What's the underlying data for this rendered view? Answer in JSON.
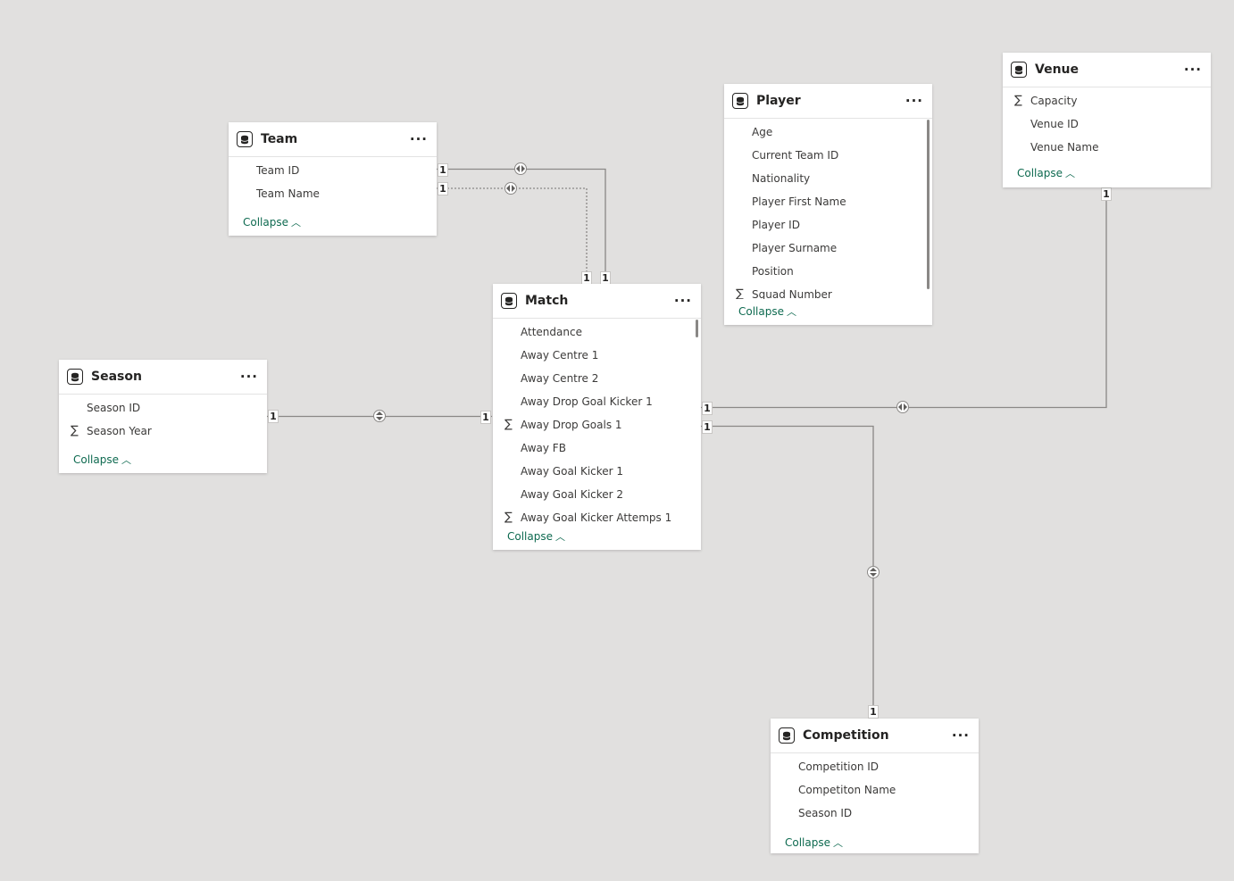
{
  "tables": {
    "team": {
      "title": "Team",
      "fields": [
        {
          "label": "Team ID",
          "sigma": false
        },
        {
          "label": "Team Name",
          "sigma": false
        }
      ],
      "collapse": "Collapse"
    },
    "match": {
      "title": "Match",
      "fields": [
        {
          "label": "Attendance",
          "sigma": false
        },
        {
          "label": "Away Centre 1",
          "sigma": false
        },
        {
          "label": "Away Centre 2",
          "sigma": false
        },
        {
          "label": "Away Drop Goal Kicker 1",
          "sigma": false
        },
        {
          "label": "Away Drop Goals 1",
          "sigma": true
        },
        {
          "label": "Away FB",
          "sigma": false
        },
        {
          "label": "Away Goal Kicker 1",
          "sigma": false
        },
        {
          "label": "Away Goal Kicker 2",
          "sigma": false
        },
        {
          "label": "Away Goal Kicker Attemps 1",
          "sigma": true
        }
      ],
      "collapse": "Collapse"
    },
    "season": {
      "title": "Season",
      "fields": [
        {
          "label": "Season ID",
          "sigma": false
        },
        {
          "label": "Season Year",
          "sigma": true
        }
      ],
      "collapse": "Collapse"
    },
    "player": {
      "title": "Player",
      "fields": [
        {
          "label": "Age",
          "sigma": false
        },
        {
          "label": "Current Team ID",
          "sigma": false
        },
        {
          "label": "Nationality",
          "sigma": false
        },
        {
          "label": "Player First Name",
          "sigma": false
        },
        {
          "label": "Player ID",
          "sigma": false
        },
        {
          "label": "Player Surname",
          "sigma": false
        },
        {
          "label": "Position",
          "sigma": false
        },
        {
          "label": "Squad Number",
          "sigma": true
        }
      ],
      "collapse": "Collapse"
    },
    "venue": {
      "title": "Venue",
      "fields": [
        {
          "label": "Capacity",
          "sigma": true
        },
        {
          "label": "Venue ID",
          "sigma": false
        },
        {
          "label": "Venue Name",
          "sigma": false
        }
      ],
      "collapse": "Collapse"
    },
    "competition": {
      "title": "Competition",
      "fields": [
        {
          "label": "Competition ID",
          "sigma": false
        },
        {
          "label": "Competiton Name",
          "sigma": false
        },
        {
          "label": "Season ID",
          "sigma": false
        }
      ],
      "collapse": "Collapse"
    }
  },
  "relationships": [
    {
      "from": "Team",
      "to": "Match",
      "from_cardinality": "1",
      "to_cardinality": "1",
      "active": true
    },
    {
      "from": "Team",
      "to": "Match",
      "from_cardinality": "1",
      "to_cardinality": "1",
      "active": false
    },
    {
      "from": "Season",
      "to": "Match",
      "from_cardinality": "1",
      "to_cardinality": "1",
      "active": true
    },
    {
      "from": "Match",
      "to": "Venue",
      "from_cardinality": "1",
      "to_cardinality": "1",
      "active": true
    },
    {
      "from": "Match",
      "to": "Competition",
      "from_cardinality": "1",
      "to_cardinality": "1",
      "active": true
    }
  ],
  "icons": {
    "table": "table-icon",
    "more": "more-options-icon",
    "sigma": "sigma-icon",
    "collapse": "chevron-up-icon"
  },
  "colors": {
    "canvas": "#e1e0df",
    "card": "#ffffff",
    "link_text": "#0e6a50",
    "line": "#8a8886"
  }
}
